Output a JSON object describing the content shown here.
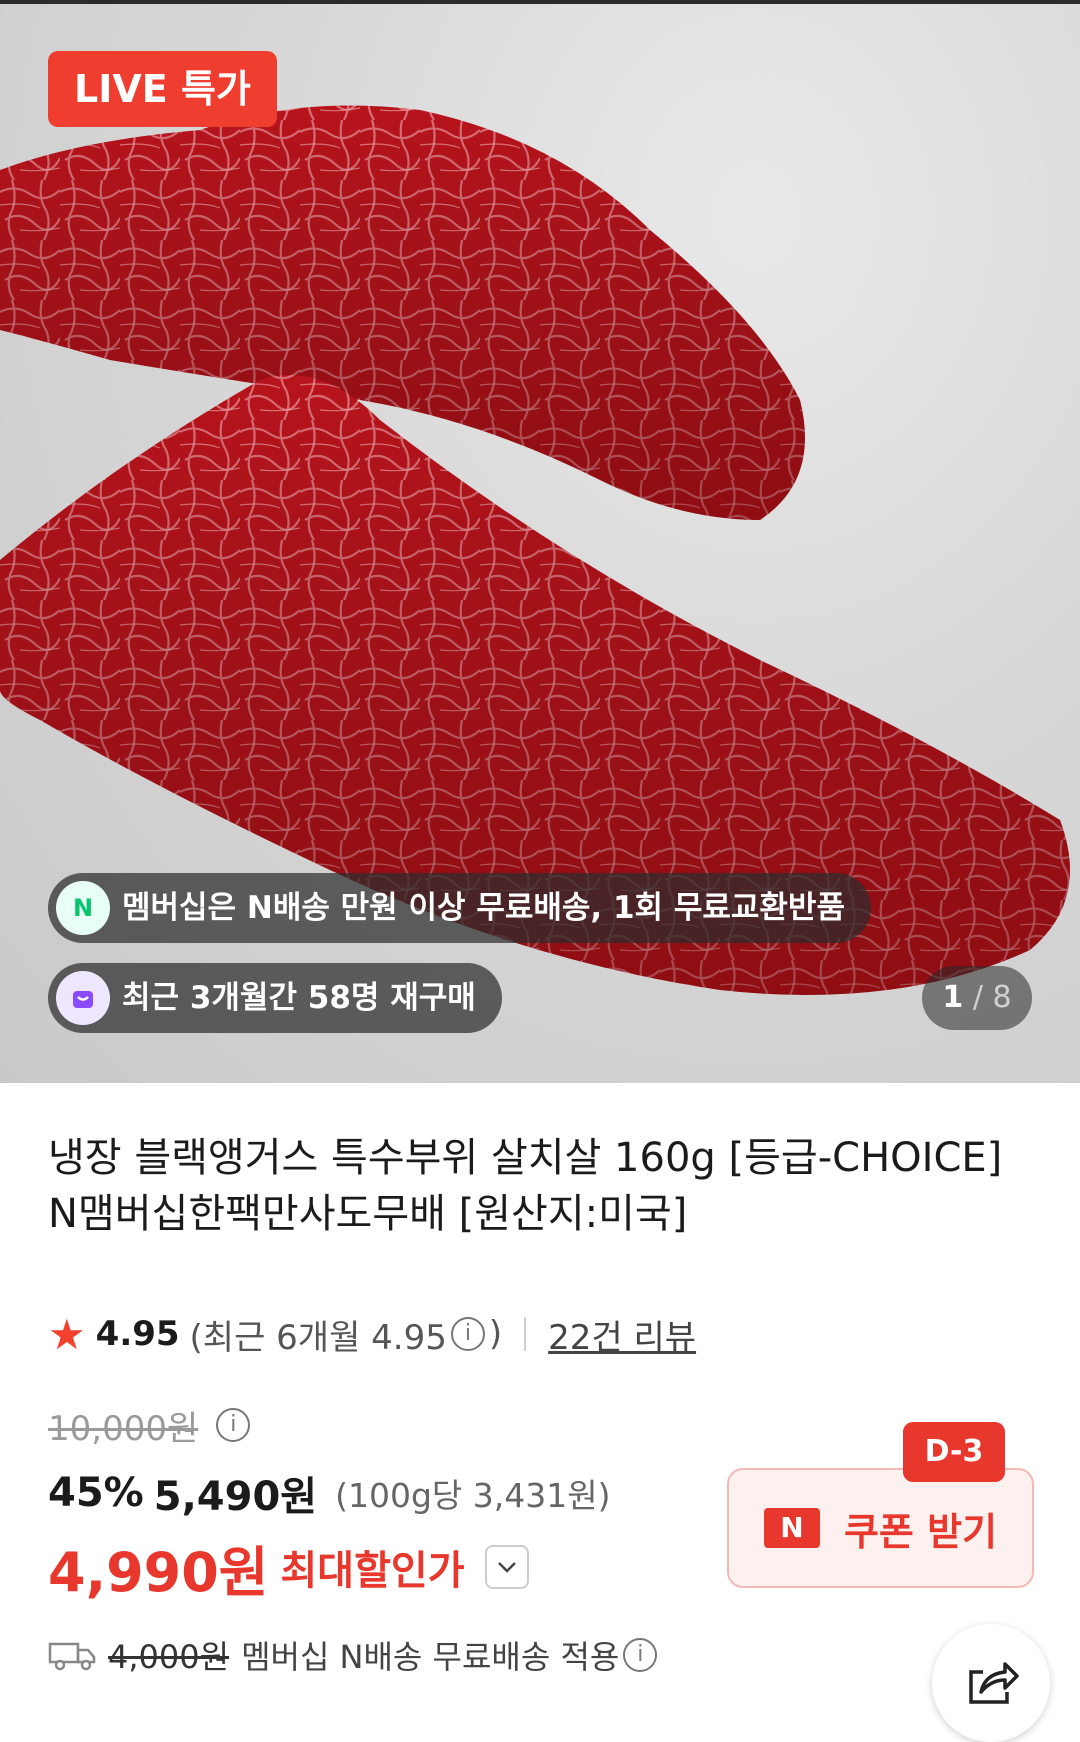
{
  "hero": {
    "live_badge": "LIVE 특가",
    "membership_notice": "멤버십은 N배송 만원 이상 무료배송, 1회 무료교환반품",
    "membership_icon": "N",
    "repurchase_notice": "최근 3개월간 58명 재구매",
    "repurchase_icon": "bag-icon",
    "counter_current": "1",
    "counter_total": "8"
  },
  "product": {
    "title": "냉장 블랙앵거스 특수부위 살치살 160g [등급-CHOICE] N맴버십한팩만사도무배 [원산지:미국]",
    "rating": "4.95",
    "recent_rating_text": "(최근 6개월 4.95",
    "recent_rating_close": ")",
    "reviews": "22건 리뷰"
  },
  "price": {
    "original": "10,000원",
    "discount_pct": "45%",
    "sale_price": "5,490원",
    "unit_price": "(100g당 3,431원)",
    "best_price": "4,990원",
    "best_label": "최대할인가"
  },
  "coupon": {
    "label": "쿠폰 받기",
    "logo": "N",
    "dday": "D-3"
  },
  "shipping": {
    "original_fee": "4,000원",
    "text": "멤버십 N배송 무료배송 적용"
  },
  "colors": {
    "accent_red": "#e8372c",
    "live_red": "#ef3e2f"
  }
}
